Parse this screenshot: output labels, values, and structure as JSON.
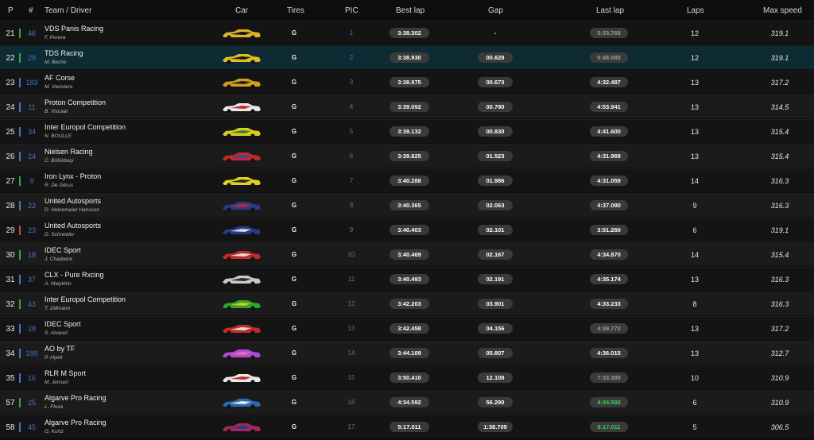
{
  "headers": {
    "p": "P",
    "num": "#",
    "team_driver": "Team / Driver",
    "car": "Car",
    "tires": "Tires",
    "pic": "PIC",
    "best_lap": "Best lap",
    "gap": "Gap",
    "last_lap": "Last lap",
    "laps": "Laps",
    "max_speed": "Max speed"
  },
  "colors": {
    "green_bar": "#2ea84a",
    "blue_bar": "#3f76c4",
    "purple_bar": "#8a6bd6",
    "selected_row": "#0e2b33"
  },
  "rows": [
    {
      "p": "21",
      "num": "46",
      "team": "VDS Panis Racing",
      "driver": "F. Perera",
      "tires": "G",
      "pic": "1",
      "best": "3:38.302",
      "gap": "-",
      "last": "5:33.768",
      "laps": "12",
      "speed": "319.1",
      "bar": "#2ea84a",
      "car": [
        "#d8b52a",
        "#111111"
      ],
      "last_style": "grey"
    },
    {
      "p": "22",
      "num": "29",
      "team": "TDS Racing",
      "driver": "M. Beche",
      "tires": "G",
      "pic": "2",
      "best": "3:38.930",
      "gap": "00.628",
      "last": "5:48.885",
      "laps": "12",
      "speed": "319.1",
      "bar": "#2ea84a",
      "car": [
        "#e0c020",
        "#1a1a1a"
      ],
      "last_style": "grey"
    },
    {
      "p": "23",
      "num": "183",
      "team": "AF Corse",
      "driver": "M. Vaxiviere",
      "tires": "G",
      "pic": "3",
      "best": "3:38.975",
      "gap": "00.673",
      "last": "4:32.487",
      "laps": "13",
      "speed": "317.2",
      "bar": "#3f76c4",
      "car": [
        "#d2a21c",
        "#222222"
      ],
      "last_style": ""
    },
    {
      "p": "24",
      "num": "11",
      "team": "Proton Competition",
      "driver": "B. Viscaal",
      "tires": "G",
      "pic": "4",
      "best": "3:39.092",
      "gap": "00.790",
      "last": "4:53.941",
      "laps": "13",
      "speed": "314.5",
      "bar": "#3f76c4",
      "car": [
        "#e8e8e8",
        "#c42a2a"
      ],
      "last_style": ""
    },
    {
      "p": "25",
      "num": "34",
      "team": "Inter Europol Competition",
      "driver": "N. BOULLE",
      "tires": "G",
      "pic": "5",
      "best": "3:39.132",
      "gap": "00.830",
      "last": "4:41.600",
      "laps": "13",
      "speed": "315.4",
      "bar": "#3f76c4",
      "car": [
        "#e0c820",
        "#2a8a2a"
      ],
      "last_style": ""
    },
    {
      "p": "26",
      "num": "24",
      "team": "Nielsen Racing",
      "driver": "C. Bölükbaşi",
      "tires": "G",
      "pic": "6",
      "best": "3:39.825",
      "gap": "01.523",
      "last": "4:31.969",
      "laps": "13",
      "speed": "315.4",
      "bar": "#3f76c4",
      "car": [
        "#c22a2a",
        "#2a4ab0"
      ],
      "last_style": ""
    },
    {
      "p": "27",
      "num": "9",
      "team": "Iron Lynx - Proton",
      "driver": "R. De Gérus",
      "tires": "G",
      "pic": "7",
      "best": "3:40.288",
      "gap": "01.986",
      "last": "4:31.059",
      "laps": "14",
      "speed": "316.3",
      "bar": "#2ea84a",
      "car": [
        "#e0d020",
        "#2a2a2a"
      ],
      "last_style": ""
    },
    {
      "p": "28",
      "num": "22",
      "team": "United Autosports",
      "driver": "D. Heinemeier Hansson",
      "tires": "G",
      "pic": "8",
      "best": "3:40.365",
      "gap": "02.063",
      "last": "4:37.090",
      "laps": "9",
      "speed": "316.3",
      "bar": "#3f76c4",
      "car": [
        "#2a3a8a",
        "#c42a2a"
      ],
      "last_style": ""
    },
    {
      "p": "29",
      "num": "23",
      "team": "United Autosports",
      "driver": "D. Schneider",
      "tires": "G",
      "pic": "9",
      "best": "3:40.403",
      "gap": "02.101",
      "last": "3:51.260",
      "laps": "6",
      "speed": "319.1",
      "bar": "#c44a4a",
      "car": [
        "#2a3a8a",
        "#d8d8d8"
      ],
      "last_style": ""
    },
    {
      "p": "30",
      "num": "18",
      "team": "IDEC Sport",
      "driver": "J. Chadwick",
      "tires": "G",
      "pic": "10",
      "best": "3:40.469",
      "gap": "02.167",
      "last": "4:34.870",
      "laps": "14",
      "speed": "315.4",
      "bar": "#2ea84a",
      "car": [
        "#c42a2a",
        "#dddddd"
      ],
      "last_style": ""
    },
    {
      "p": "31",
      "num": "37",
      "team": "CLX - Pure Rxcing",
      "driver": "A. Malykhin",
      "tires": "G",
      "pic": "11",
      "best": "3:40.493",
      "gap": "02.191",
      "last": "4:35.174",
      "laps": "13",
      "speed": "316.3",
      "bar": "#3f76c4",
      "car": [
        "#c8c8c8",
        "#2a2a2a"
      ],
      "last_style": ""
    },
    {
      "p": "32",
      "num": "43",
      "team": "Inter Europol Competition",
      "driver": "T. Dillmann",
      "tires": "G",
      "pic": "12",
      "best": "3:42.203",
      "gap": "03.901",
      "last": "4:33.233",
      "laps": "8",
      "speed": "316.3",
      "bar": "#2ea84a",
      "car": [
        "#2aa82a",
        "#e0c020"
      ],
      "last_style": ""
    },
    {
      "p": "33",
      "num": "28",
      "team": "IDEC Sport",
      "driver": "S. Alvarez",
      "tires": "G",
      "pic": "13",
      "best": "3:42.458",
      "gap": "04.156",
      "last": "4:39.772",
      "laps": "13",
      "speed": "317.2",
      "bar": "#3f76c4",
      "car": [
        "#c42a2a",
        "#dddddd"
      ],
      "last_style": "grey"
    },
    {
      "p": "34",
      "num": "199",
      "team": "AO by TF",
      "driver": "P. Hyett",
      "tires": "G",
      "pic": "14",
      "best": "3:44.109",
      "gap": "05.807",
      "last": "4:36.015",
      "laps": "13",
      "speed": "312.7",
      "bar": "#3f76c4",
      "car": [
        "#b04ad0",
        "#e070b0"
      ],
      "last_style": ""
    },
    {
      "p": "35",
      "num": "16",
      "team": "RLR M Sport",
      "driver": "M. Jensen",
      "tires": "G",
      "pic": "15",
      "best": "3:50.410",
      "gap": "12.108",
      "last": "7:33.385",
      "laps": "10",
      "speed": "310.9",
      "bar": "#3f76c4",
      "car": [
        "#e8e8e8",
        "#c42a2a"
      ],
      "last_style": "grey"
    },
    {
      "p": "57",
      "num": "25",
      "team": "Algarve Pro Racing",
      "driver": "L. Fluxa",
      "tires": "G",
      "pic": "16",
      "best": "4:34.592",
      "gap": "56.290",
      "last": "4:34.592",
      "laps": "6",
      "speed": "310.9",
      "bar": "#2ea84a",
      "car": [
        "#2a6ab0",
        "#e8e8e8"
      ],
      "last_style": "green"
    },
    {
      "p": "58",
      "num": "45",
      "team": "Algarve Pro Racing",
      "driver": "G. Kurtz",
      "tires": "G",
      "pic": "17",
      "best": "5:17.011",
      "gap": "1:38.709",
      "last": "5:17.011",
      "laps": "5",
      "speed": "306.5",
      "bar": "#3f76c4",
      "car": [
        "#a02a5a",
        "#2a3a8a"
      ],
      "last_style": "green"
    }
  ]
}
